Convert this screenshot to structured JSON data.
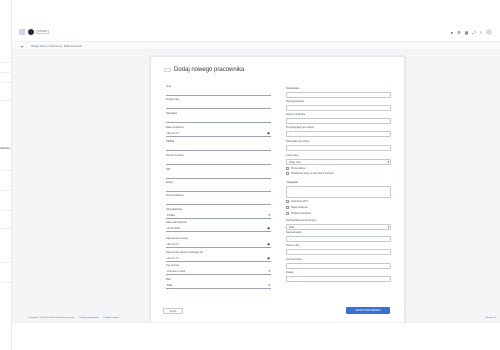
{
  "topbar": {
    "brand_pill": "ekla.space",
    "icons": [
      "notification-icon",
      "settings-icon",
      "grid-icon",
      "expand-icon",
      "menu-icon"
    ]
  },
  "breadcrumb": "Miesiąc Mienne  /  Pracownicy  /  Dodaj Pracownik",
  "sidebar": {
    "nav_label": "Odbiórka"
  },
  "card": {
    "title": "Dodaj nowego pracownika",
    "left_fields": [
      {
        "label": "Imię",
        "value": ""
      },
      {
        "label": "Drugie imię",
        "value": ""
      },
      {
        "label": "Nazwisko",
        "value": ""
      },
      {
        "label": "Data urodzenia",
        "value": "dd.mm.rrrr"
      },
      {
        "label": "PESEL",
        "value": ""
      },
      {
        "label": "Numer dowodu",
        "value": ""
      },
      {
        "label": "NIP",
        "value": ""
      },
      {
        "label": "Email",
        "value": ""
      },
      {
        "label": "Numer telefonu",
        "value": ""
      },
      {
        "label": "Obywatelstwo",
        "value": "Polska"
      },
      {
        "label": "Data zatrudnienia",
        "value": "30.10.2024"
      },
      {
        "label": "Data końca umowy",
        "value": "dd.mm.rrrr"
      },
      {
        "label": "Data końca okresu próbnego do",
        "value": "dd.mm.rrrr"
      },
      {
        "label": "Typ umowy",
        "value": "Umowa o pracę"
      },
      {
        "label": "Płeć",
        "value": "Brak"
      }
    ],
    "right_fields": [
      {
        "label": "Stanowisko",
        "value": ""
      },
      {
        "label": "Wynagrodzenie",
        "value": ""
      },
      {
        "label": "Numer rachunku",
        "value": ""
      },
      {
        "label": "Przysługujący dni urlopu",
        "value": ""
      },
      {
        "label": "Pozostałe dni urlopu",
        "value": ""
      },
      {
        "label": "Czas pracy",
        "value": "Pełny etat"
      }
    ],
    "checks_a": [
      "Praca zdalna",
      "Wrażliwość pracy w warunkach trudnych"
    ],
    "notes_label": "Uwagi/plik",
    "checks_b": [
      "Zwolnienie ZUS",
      "Status studenta",
      "Praktyki zawodowe"
    ],
    "right_fields_b": [
      {
        "label": "Rodzaj Dokumentu/Zeszyt",
        "value": "Brak"
      },
      {
        "label": "Nazwa banku",
        "value": ""
      },
      {
        "label": "Numer ulicy",
        "value": ""
      },
      {
        "label": "Kod pocztowy",
        "value": ""
      },
      {
        "label": "Uwagi",
        "value": ""
      }
    ],
    "back_button": "Anuluj",
    "save_button": "ZAPISZ PRACOWNIKA"
  },
  "footer": {
    "copyright": "Copyright © 2014-2024 ekla. All rights reserved.",
    "links": [
      "Polityka prywatności",
      "Polityka cookies"
    ],
    "right": "Wersja 1.0"
  }
}
